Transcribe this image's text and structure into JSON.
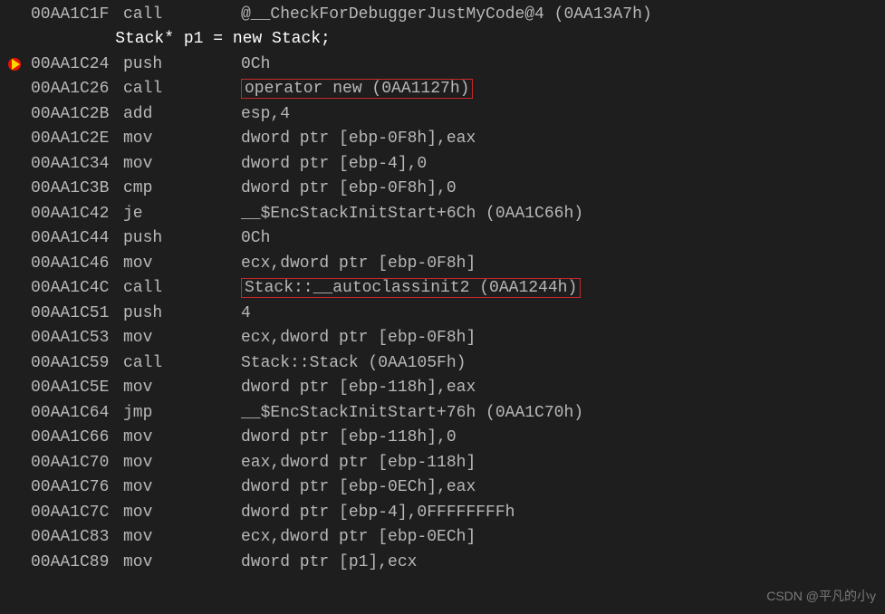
{
  "source_line": "    Stack* p1 = new Stack;",
  "rows": [
    {
      "bp": false,
      "addr": "00AA1C1F",
      "mnem": "call",
      "oper": "@__CheckForDebuggerJustMyCode@4 (0AA13A7h)",
      "hl": false,
      "source": false
    },
    {
      "bp": false,
      "addr": "",
      "mnem": "",
      "oper": "",
      "hl": false,
      "source": true
    },
    {
      "bp": true,
      "addr": "00AA1C24",
      "mnem": "push",
      "oper": "0Ch",
      "hl": false,
      "source": false
    },
    {
      "bp": false,
      "addr": "00AA1C26",
      "mnem": "call",
      "oper": "operator new (0AA1127h)",
      "hl": true,
      "source": false
    },
    {
      "bp": false,
      "addr": "00AA1C2B",
      "mnem": "add",
      "oper": "esp,4",
      "hl": false,
      "source": false
    },
    {
      "bp": false,
      "addr": "00AA1C2E",
      "mnem": "mov",
      "oper": "dword ptr [ebp-0F8h],eax",
      "hl": false,
      "source": false
    },
    {
      "bp": false,
      "addr": "00AA1C34",
      "mnem": "mov",
      "oper": "dword ptr [ebp-4],0",
      "hl": false,
      "source": false
    },
    {
      "bp": false,
      "addr": "00AA1C3B",
      "mnem": "cmp",
      "oper": "dword ptr [ebp-0F8h],0",
      "hl": false,
      "source": false
    },
    {
      "bp": false,
      "addr": "00AA1C42",
      "mnem": "je",
      "oper": "__$EncStackInitStart+6Ch (0AA1C66h)",
      "hl": false,
      "source": false
    },
    {
      "bp": false,
      "addr": "00AA1C44",
      "mnem": "push",
      "oper": "0Ch",
      "hl": false,
      "source": false
    },
    {
      "bp": false,
      "addr": "00AA1C46",
      "mnem": "mov",
      "oper": "ecx,dword ptr [ebp-0F8h]",
      "hl": false,
      "source": false
    },
    {
      "bp": false,
      "addr": "00AA1C4C",
      "mnem": "call",
      "oper": "Stack::__autoclassinit2 (0AA1244h)",
      "hl": true,
      "source": false
    },
    {
      "bp": false,
      "addr": "00AA1C51",
      "mnem": "push",
      "oper": "4",
      "hl": false,
      "source": false
    },
    {
      "bp": false,
      "addr": "00AA1C53",
      "mnem": "mov",
      "oper": "ecx,dword ptr [ebp-0F8h]",
      "hl": false,
      "source": false
    },
    {
      "bp": false,
      "addr": "00AA1C59",
      "mnem": "call",
      "oper": "Stack::Stack (0AA105Fh)",
      "hl": false,
      "source": false
    },
    {
      "bp": false,
      "addr": "00AA1C5E",
      "mnem": "mov",
      "oper": "dword ptr [ebp-118h],eax",
      "hl": false,
      "source": false
    },
    {
      "bp": false,
      "addr": "00AA1C64",
      "mnem": "jmp",
      "oper": "__$EncStackInitStart+76h (0AA1C70h)",
      "hl": false,
      "source": false
    },
    {
      "bp": false,
      "addr": "00AA1C66",
      "mnem": "mov",
      "oper": "dword ptr [ebp-118h],0",
      "hl": false,
      "source": false
    },
    {
      "bp": false,
      "addr": "00AA1C70",
      "mnem": "mov",
      "oper": "eax,dword ptr [ebp-118h]",
      "hl": false,
      "source": false
    },
    {
      "bp": false,
      "addr": "00AA1C76",
      "mnem": "mov",
      "oper": "dword ptr [ebp-0ECh],eax",
      "hl": false,
      "source": false
    },
    {
      "bp": false,
      "addr": "00AA1C7C",
      "mnem": "mov",
      "oper": "dword ptr [ebp-4],0FFFFFFFFh",
      "hl": false,
      "source": false
    },
    {
      "bp": false,
      "addr": "00AA1C83",
      "mnem": "mov",
      "oper": "ecx,dword ptr [ebp-0ECh]",
      "hl": false,
      "source": false
    },
    {
      "bp": false,
      "addr": "00AA1C89",
      "mnem": "mov",
      "oper": "dword ptr [p1],ecx",
      "hl": false,
      "source": false
    }
  ],
  "watermark": "CSDN @平凡的小y"
}
